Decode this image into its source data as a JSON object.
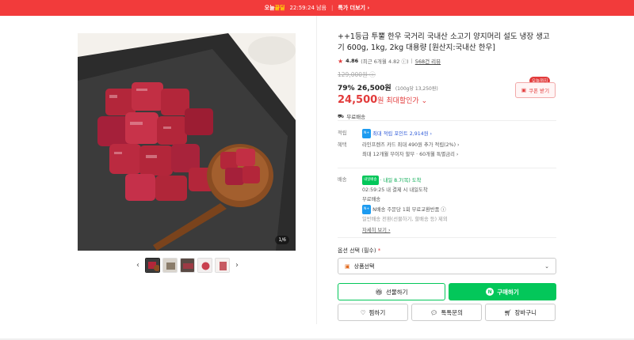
{
  "banner": {
    "deal_prefix": "오늘",
    "deal_highlight": "끝딜",
    "timer": "22:59:24 남음",
    "more": "특가 더보기 ›"
  },
  "gallery": {
    "page_indicator": "1/6"
  },
  "product": {
    "title": "++1등급 투뿔 한우 국거리 국내산 소고기 양지머리 설도 냉장 생고기 600g, 1kg, 2kg 대용량 [원산지:국내산 한우]",
    "rating": "4.86",
    "rating_detail": "(최근 6개월 4.82 ⓘ)",
    "review_count": "568건 리뷰",
    "original_price": "129,000원 ⓘ",
    "discount_percent": "79%",
    "sale_price": "26,500원",
    "unit_price": "(100g당 13,250원)",
    "best_price": "24,500",
    "best_label": "원 최대할인가 ⌄",
    "shipping": "무료배송"
  },
  "coupon": {
    "tag": "오늘까지",
    "label": "쿠폰 받기"
  },
  "points": {
    "key": "적립",
    "badge": "N+",
    "text": "최대 적립 포인트 2,914원 ›"
  },
  "benefit": {
    "key": "혜택",
    "line1": "라인프렌즈 카드 최대 490원 추가 적립(2%) ›",
    "line2": "최대 12개월 무이자 할부 · 60개월 특별금리 ›"
  },
  "delivery": {
    "key": "배송",
    "badge": "내일배송",
    "arrival": "· 내일 8.7(목) 도착",
    "cutoff": "02:59:25  내 결제 시 내일도착",
    "free": "무료배송",
    "n_badge": "N+",
    "exchange": "N배송 주문당 1회 무료교환반품 ⓘ",
    "note": "일반배송 전환(선물하기, 할배송 등) 제외",
    "detail": "자세히 보기 ›"
  },
  "option": {
    "label": "옵션 선택 (필수)",
    "required_mark": "*",
    "select_placeholder": "상품선택"
  },
  "buttons": {
    "gift": "선물하기",
    "buy": "구매하기",
    "wish": "찜하기",
    "talk": "톡톡문의",
    "cart": "장바구니"
  }
}
